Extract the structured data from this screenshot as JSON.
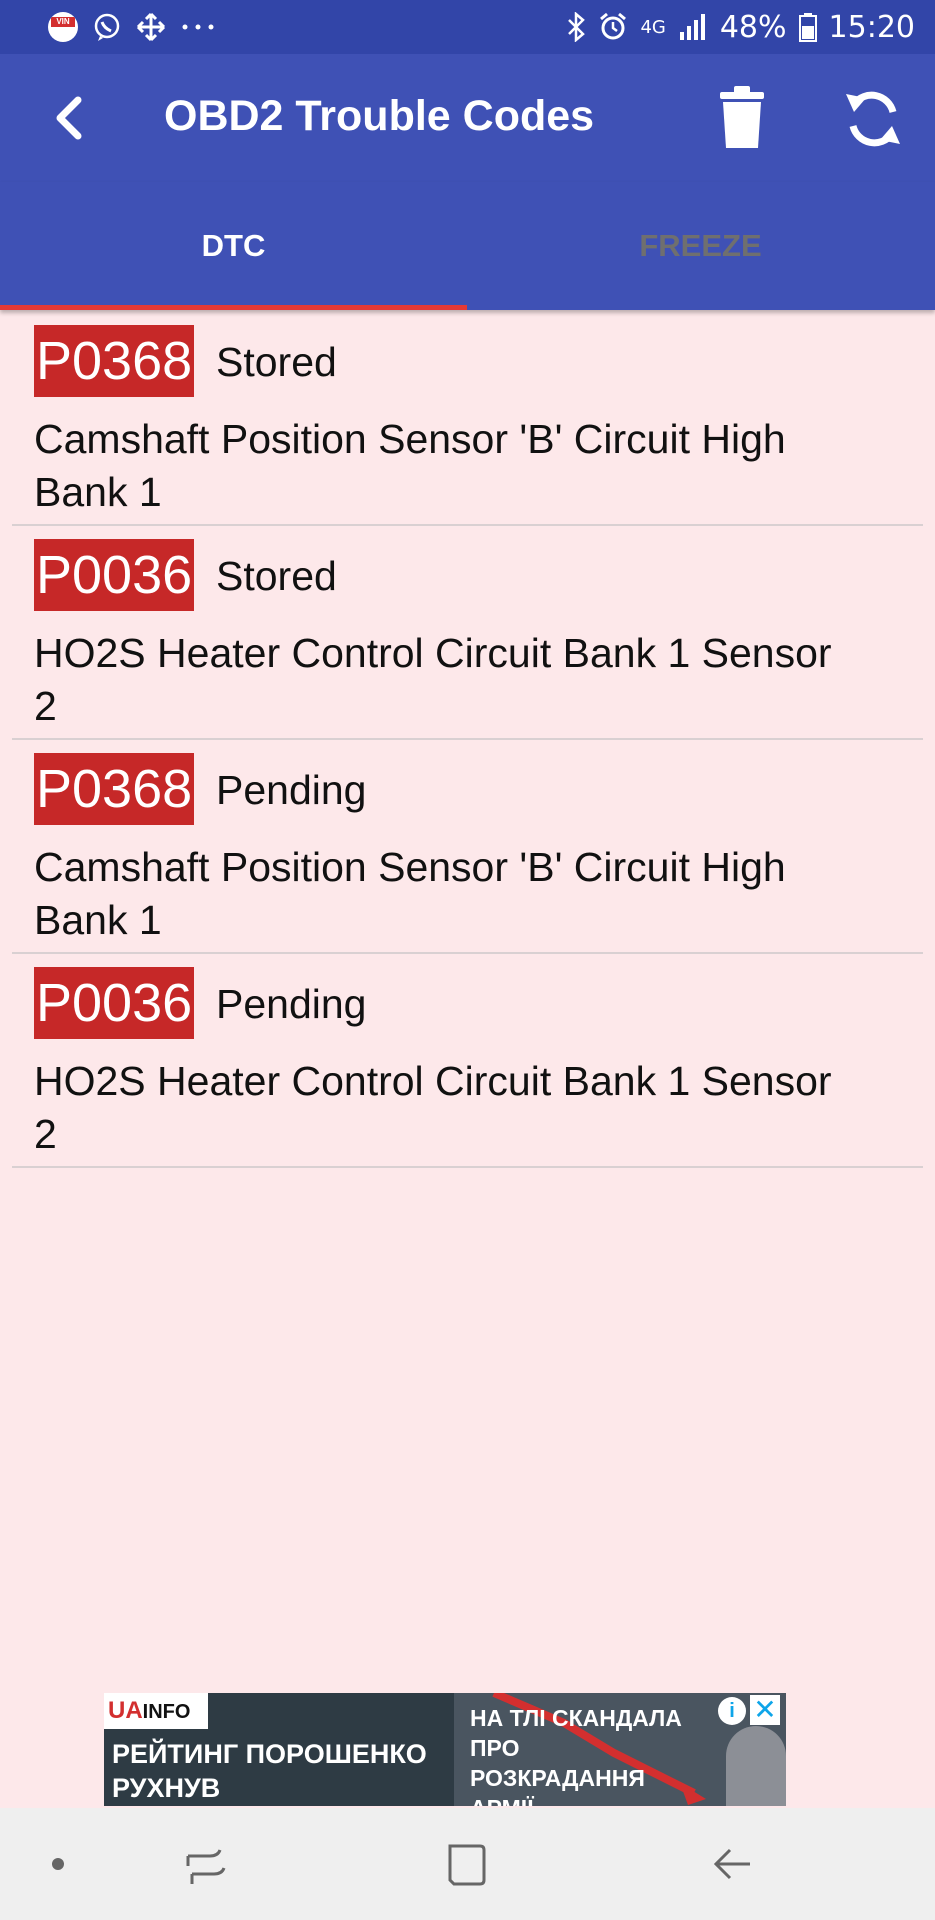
{
  "status_bar": {
    "battery": "48%",
    "time": "15:20",
    "network": "4G",
    "icons": [
      "vin-app-icon",
      "viber-icon",
      "move-icon",
      "more-icon",
      "bluetooth-icon",
      "alarm-icon",
      "signal-icon",
      "battery-icon"
    ],
    "vin_label": "VIN"
  },
  "app_bar": {
    "title": "OBD2 Trouble Codes",
    "icons": [
      "back-icon",
      "trash-icon",
      "refresh-icon"
    ]
  },
  "tabs": [
    {
      "label": "DTC",
      "selected": true
    },
    {
      "label": "FREEZE",
      "selected": false
    }
  ],
  "dtc_list": [
    {
      "code": "P0368",
      "status": "Stored",
      "description": "Camshaft Position Sensor 'B' Circuit High Bank 1"
    },
    {
      "code": "P0036",
      "status": "Stored",
      "description": "HO2S Heater Control Circuit Bank 1 Sensor 2"
    },
    {
      "code": "P0368",
      "status": "Pending",
      "description": "Camshaft Position Sensor 'B' Circuit High Bank 1"
    },
    {
      "code": "P0036",
      "status": "Pending",
      "description": "HO2S Heater Control Circuit Bank 1 Sensor 2"
    }
  ],
  "ad": {
    "logo_ua": "UA",
    "logo_info": "INFO",
    "headline": "РЕЙТИНГ ПОРОШЕНКО РУХНУВ",
    "subline": "НА ТЛІ СКАНДАЛА ПРО РОЗКРАДАННЯ АРМІЇ",
    "info_icon": "i",
    "close_icon": "✕"
  },
  "nav_bar": {
    "icons": [
      "nav-dot-icon",
      "recent-apps-icon",
      "home-icon",
      "back-arrow-icon"
    ]
  },
  "colors": {
    "app_bar": "#3f51b5",
    "status_bar": "#3245a8",
    "code_badge": "#c62828",
    "tab_indicator": "#e53935",
    "background": "#fde8ea"
  }
}
